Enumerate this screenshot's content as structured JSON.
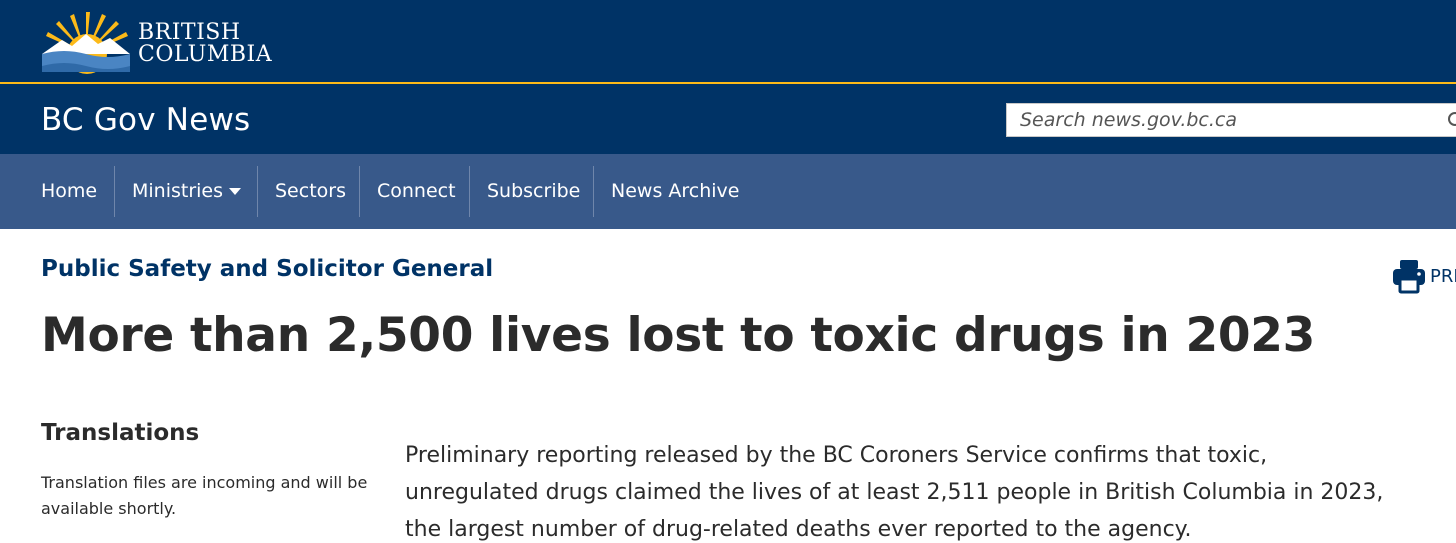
{
  "brand": {
    "logo_line1": "BRITISH",
    "logo_line2": "COLUMBIA",
    "colors": {
      "primary": "#003366",
      "gold": "#fcba19",
      "nav": "#38598a"
    }
  },
  "header": {
    "site_title": "BC Gov News",
    "search_placeholder": "Search news.gov.bc.ca"
  },
  "nav": {
    "items": [
      {
        "label": "Home"
      },
      {
        "label": "Ministries"
      },
      {
        "label": "Sectors"
      },
      {
        "label": "Connect"
      },
      {
        "label": "Subscribe"
      },
      {
        "label": "News Archive"
      }
    ]
  },
  "article": {
    "ministry": "Public Safety and Solicitor General",
    "print_label": "PRI",
    "headline": "More than 2,500 lives lost to toxic drugs in 2023",
    "lead": "Preliminary reporting released by the BC Coroners Service confirms that toxic, unregulated drugs claimed the lives of at least 2,511 people in British Columbia in 2023, the largest number of drug-related deaths ever reported to the agency."
  },
  "sidebar": {
    "translations_title": "Translations",
    "translations_body": "Translation files are incoming and will be available shortly."
  }
}
